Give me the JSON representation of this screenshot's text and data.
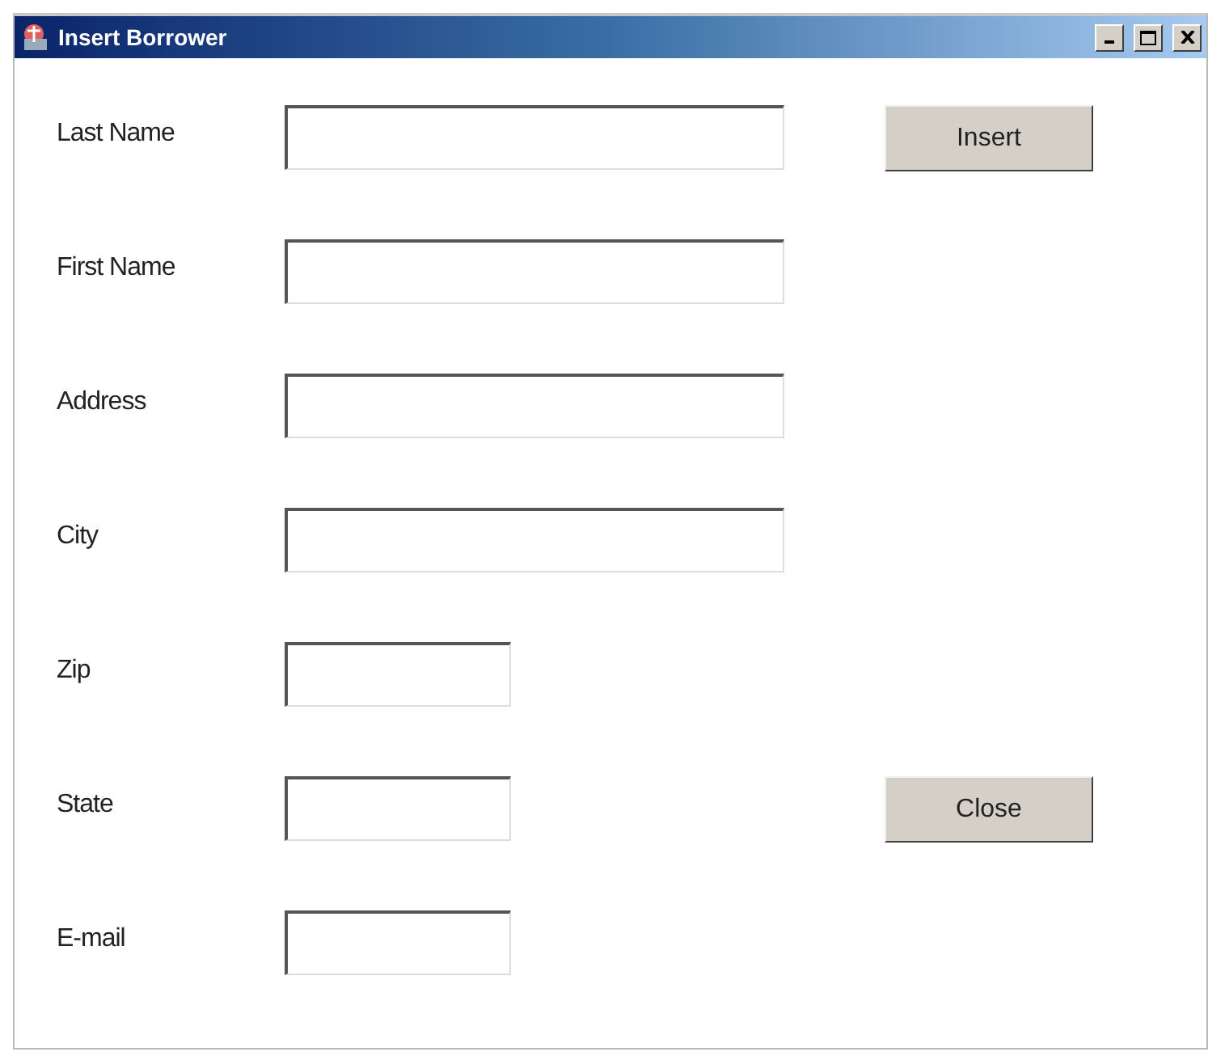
{
  "window": {
    "title": "Insert Borrower"
  },
  "fields": [
    {
      "label": "Last Name",
      "kind": "long",
      "button": "Insert"
    },
    {
      "label": "First Name",
      "kind": "long"
    },
    {
      "label": "Address",
      "kind": "long"
    },
    {
      "label": "City",
      "kind": "long"
    },
    {
      "label": "Zip",
      "kind": "short"
    },
    {
      "label": "State",
      "kind": "short",
      "button": "Close"
    },
    {
      "label": "E-mail",
      "kind": "short"
    }
  ]
}
